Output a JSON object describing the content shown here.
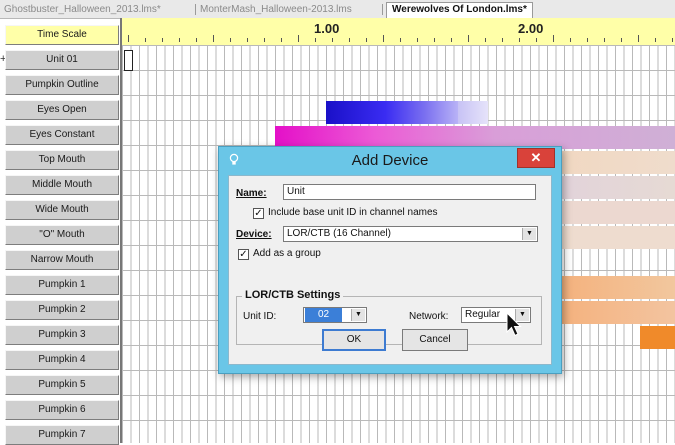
{
  "tabs": [
    {
      "label": "Ghostbuster_Halloween_2013.lms*",
      "active": false
    },
    {
      "label": "MonterMash_Halloween-2013.lms",
      "active": false
    },
    {
      "label": "Werewolves Of London.lms*",
      "active": true
    }
  ],
  "rows": [
    {
      "label": "Time Scale"
    },
    {
      "label": "Unit 01"
    },
    {
      "label": "Pumpkin Outline"
    },
    {
      "label": "Eyes Open"
    },
    {
      "label": "Eyes Constant"
    },
    {
      "label": "Top Mouth"
    },
    {
      "label": "Middle Mouth"
    },
    {
      "label": "Wide Mouth"
    },
    {
      "label": "\"O\" Mouth"
    },
    {
      "label": "Narrow Mouth"
    },
    {
      "label": "Pumpkin 1"
    },
    {
      "label": "Pumpkin 2"
    },
    {
      "label": "Pumpkin 3"
    },
    {
      "label": "Pumpkin 4"
    },
    {
      "label": "Pumpkin 5"
    },
    {
      "label": "Pumpkin 6"
    },
    {
      "label": "Pumpkin 7"
    }
  ],
  "expand_symbol": "+",
  "timescale": {
    "ticks": [
      "1.00",
      "2.00"
    ]
  },
  "colors": {
    "eyes_open": "#2a18e0",
    "eyes_constant": "#e019c8",
    "pumpkin_orange": "#f08a2a",
    "dialog_frame": "#6ac6e7",
    "close_button": "#d9423a",
    "timescale_bg": "#ffffa8"
  },
  "dialog": {
    "title": "Add Device",
    "close_symbol": "✕",
    "name_label": "Name:",
    "name_value": "Unit",
    "include_label": "Include base unit ID in channel names",
    "include_checked": true,
    "device_label": "Device:",
    "device_value": "LOR/CTB (16 Channel)",
    "group_label": "Add as a group",
    "group_checked": true,
    "settings_title": "LOR/CTB Settings",
    "unit_id_label": "Unit ID:",
    "unit_id_value": "02",
    "network_label": "Network:",
    "network_value": "Regular",
    "ok_label": "OK",
    "cancel_label": "Cancel"
  }
}
